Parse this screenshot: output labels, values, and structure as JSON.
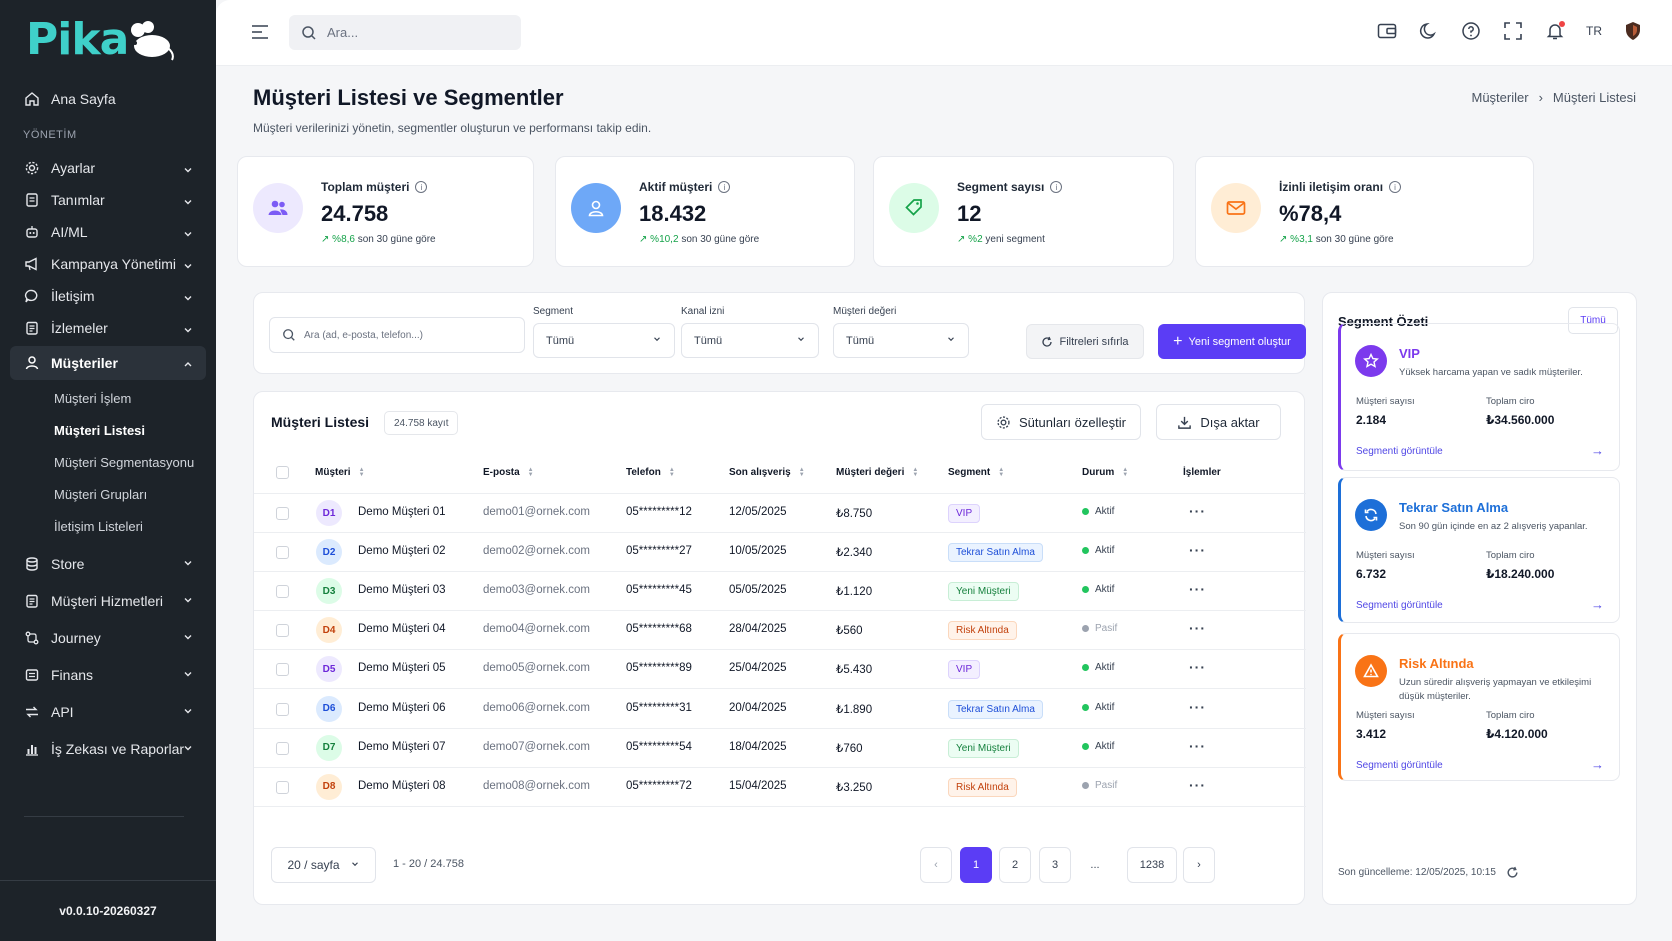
{
  "app": {
    "logo": "Pika",
    "version": "v0.0.10-20260327"
  },
  "sidebar": {
    "home": "Ana Sayfa",
    "section": "YÖNETİM",
    "items": [
      {
        "label": "Ayarlar",
        "icon": "gear-icon"
      },
      {
        "label": "Tanımlar",
        "icon": "file-icon"
      },
      {
        "label": "AI/ML",
        "icon": "robot-icon"
      },
      {
        "label": "Kampanya Yönetimi",
        "icon": "megaphone-icon"
      },
      {
        "label": "İletişim",
        "icon": "chat-icon"
      },
      {
        "label": "İzlemeler",
        "icon": "clipboard-icon"
      }
    ],
    "active": {
      "label": "Müşteriler",
      "icon": "user-icon"
    },
    "subitems": [
      "Müşteri İşlem",
      "Müşteri Listesi",
      "Müşteri Segmentasyonu",
      "Müşteri Grupları",
      "İletişim Listeleri"
    ],
    "current_sub": "Müşteri Listesi",
    "items2": [
      {
        "label": "Store",
        "icon": "database-icon"
      },
      {
        "label": "Müşteri Hizmetleri",
        "icon": "clipboard-icon"
      },
      {
        "label": "Journey",
        "icon": "journey-icon"
      },
      {
        "label": "Finans",
        "icon": "finance-icon"
      },
      {
        "label": "API",
        "icon": "api-icon"
      },
      {
        "label": "İş Zekası ve Raporlar",
        "icon": "chart-icon"
      }
    ]
  },
  "topbar": {
    "search_placeholder": "Ara...",
    "lang": "TR"
  },
  "page": {
    "title": "Müşteri Listesi ve Segmentler",
    "subtitle": "Müşteri verilerinizi yönetin, segmentler oluşturun ve performansı takip edin.",
    "breadcrumb": [
      "Müşteriler",
      "Müşteri Listesi"
    ]
  },
  "stats": [
    {
      "label": "Toplam müşteri",
      "value": "24.758",
      "change": "%8,6",
      "note": "son 30 güne göre",
      "color": "#7c5cf5",
      "bg": "#ede9fe"
    },
    {
      "label": "Aktif müşteri",
      "value": "18.432",
      "change": "%10,2",
      "note": "son 30 güne göre",
      "color": "#ffffff",
      "bg": "#6ea8f7"
    },
    {
      "label": "Segment sayısı",
      "value": "12",
      "change": "%2",
      "note": "yeni segment",
      "color": "#16a34a",
      "bg": "#dcfce7"
    },
    {
      "label": "İzinli iletişim oranı",
      "value": "%78,4",
      "change": "%3,1",
      "note": "son 30 güne göre",
      "color": "#f97316",
      "bg": "#ffedd5"
    }
  ],
  "filters": {
    "search_placeholder": "Ara (ad, e-posta, telefon...)",
    "segment": {
      "label": "Segment",
      "value": "Tümü"
    },
    "channel": {
      "label": "Kanal izni",
      "value": "Tümü"
    },
    "value": {
      "label": "Müşteri değeri",
      "value": "Tümü"
    },
    "reset": "Filtreleri sıfırla",
    "new_segment": "Yeni segment oluştur"
  },
  "table": {
    "title": "Müşteri Listesi",
    "count": "24.758 kayıt",
    "customize": "Sütunları özelleştir",
    "export": "Dışa aktar",
    "headers": {
      "customer": "Müşteri",
      "email": "E-posta",
      "phone": "Telefon",
      "last": "Son alışveriş",
      "value": "Müşteri değeri",
      "segment": "Segment",
      "status": "Durum",
      "actions": "İşlemler"
    },
    "rows": [
      {
        "code": "D1",
        "name": "Demo Müşteri 01",
        "email": "demo01@ornek.com",
        "phone": "05*********12",
        "date": "12/05/2025",
        "value": "₺8.750",
        "segment": "VIP",
        "status": "Aktif"
      },
      {
        "code": "D2",
        "name": "Demo Müşteri 02",
        "email": "demo02@ornek.com",
        "phone": "05*********27",
        "date": "10/05/2025",
        "value": "₺2.340",
        "segment": "Tekrar Satın Alma",
        "status": "Aktif"
      },
      {
        "code": "D3",
        "name": "Demo Müşteri 03",
        "email": "demo03@ornek.com",
        "phone": "05*********45",
        "date": "05/05/2025",
        "value": "₺1.120",
        "segment": "Yeni Müşteri",
        "status": "Aktif"
      },
      {
        "code": "D4",
        "name": "Demo Müşteri 04",
        "email": "demo04@ornek.com",
        "phone": "05*********68",
        "date": "28/04/2025",
        "value": "₺560",
        "segment": "Risk Altında",
        "status": "Pasif"
      },
      {
        "code": "D5",
        "name": "Demo Müşteri 05",
        "email": "demo05@ornek.com",
        "phone": "05*********89",
        "date": "25/04/2025",
        "value": "₺5.430",
        "segment": "VIP",
        "status": "Aktif"
      },
      {
        "code": "D6",
        "name": "Demo Müşteri 06",
        "email": "demo06@ornek.com",
        "phone": "05*********31",
        "date": "20/04/2025",
        "value": "₺1.890",
        "segment": "Tekrar Satın Alma",
        "status": "Aktif"
      },
      {
        "code": "D7",
        "name": "Demo Müşteri 07",
        "email": "demo07@ornek.com",
        "phone": "05*********54",
        "date": "18/04/2025",
        "value": "₺760",
        "segment": "Yeni Müşteri",
        "status": "Aktif"
      },
      {
        "code": "D8",
        "name": "Demo Müşteri 08",
        "email": "demo08@ornek.com",
        "phone": "05*********72",
        "date": "15/04/2025",
        "value": "₺3.250",
        "segment": "Risk Altında",
        "status": "Pasif"
      }
    ],
    "per_page": "20 / sayfa",
    "range": "1 - 20 / 24.758",
    "pages": [
      "1",
      "2",
      "3",
      "...",
      "1238"
    ]
  },
  "segment_summary": {
    "title": "Segment Özeti",
    "all": "Tümü",
    "count_label": "Müşteri sayısı",
    "revenue_label": "Toplam ciro",
    "link": "Segmenti görüntüle",
    "segments": [
      {
        "name": "VIP",
        "desc": "Yüksek harcama yapan ve sadık müşteriler.",
        "count": "2.184",
        "revenue": "₺34.560.000",
        "color": "#7c3aed"
      },
      {
        "name": "Tekrar Satın Alma",
        "desc": "Son 90 gün içinde en az 2 alışveriş yapanlar.",
        "count": "6.732",
        "revenue": "₺18.240.000",
        "color": "#1d6fd8"
      },
      {
        "name": "Risk Altında",
        "desc": "Uzun süredir alışveriş yapmayan ve etkileşimi düşük müşteriler.",
        "count": "3.412",
        "revenue": "₺4.120.000",
        "color": "#f97316"
      }
    ],
    "updated": "Son güncelleme: 12/05/2025, 10:15"
  }
}
